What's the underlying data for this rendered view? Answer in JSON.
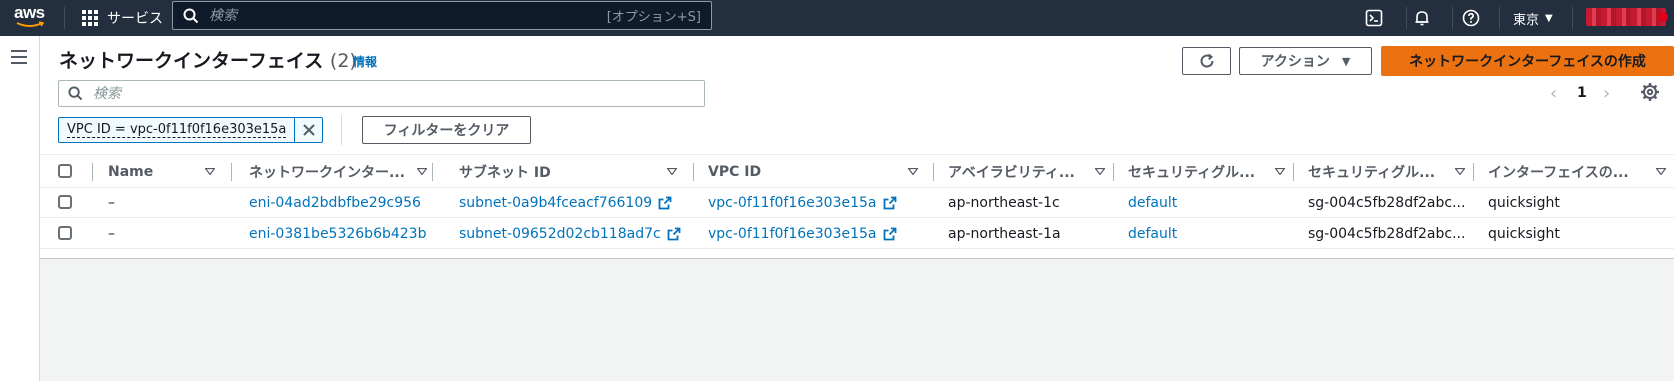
{
  "topnav": {
    "logo": "aws",
    "services_label": "サービス",
    "search_placeholder": "検索",
    "search_shortcut": "[オプション+S]",
    "region": "東京",
    "icons": [
      "cloudshell-icon",
      "bell-icon",
      "help-icon"
    ]
  },
  "page": {
    "title": "ネットワークインターフェイス",
    "count": "(2)",
    "info": "情報",
    "actions_label": "アクション",
    "create_label": "ネットワークインターフェイスの作成",
    "search_placeholder": "検索",
    "filter_token": "VPC ID = vpc-0f11f0f16e303e15a",
    "clear_filter_label": "フィルターをクリア",
    "page_number": "1"
  },
  "table": {
    "columns": [
      "Name",
      "ネットワークインター...",
      "サブネット ID",
      "VPC ID",
      "アベイラビリティ...",
      "セキュリティグル...",
      "セキュリティグル...",
      "インターフェイスの..."
    ],
    "rows": [
      {
        "name": "–",
        "eni": "eni-04ad2bdbfbe29c956",
        "subnet": "subnet-0a9b4fceacf766109",
        "vpc": "vpc-0f11f0f16e303e15a",
        "az": "ap-northeast-1c",
        "sg_name": "default",
        "sg_id": "sg-004c5fb28df2abc...",
        "iface": "quicksight"
      },
      {
        "name": "–",
        "eni": "eni-0381be5326b6b423b",
        "subnet": "subnet-09652d02cb118ad7c",
        "vpc": "vpc-0f11f0f16e303e15a",
        "az": "ap-northeast-1a",
        "sg_name": "default",
        "sg_id": "sg-004c5fb28df2abc...",
        "iface": "quicksight"
      }
    ]
  },
  "colors": {
    "nav_bg": "#232f3e",
    "primary_button": "#ec7211",
    "link": "#0073bb"
  }
}
